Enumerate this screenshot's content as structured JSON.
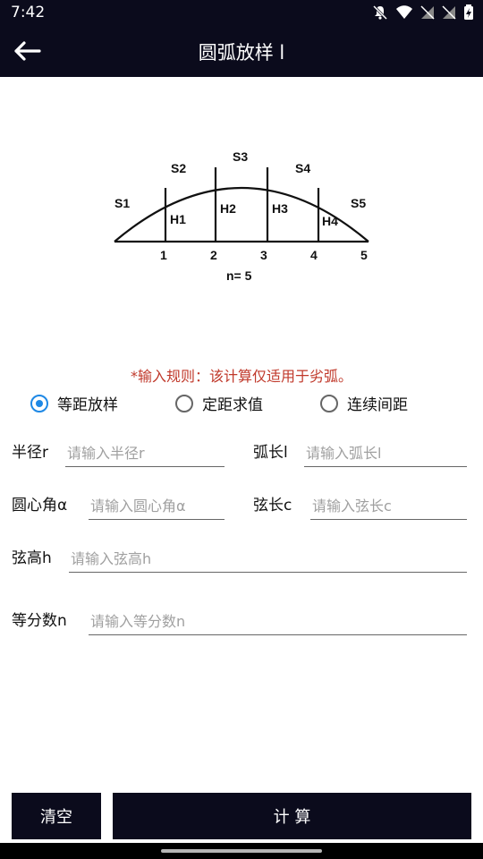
{
  "status": {
    "time": "7:42"
  },
  "header": {
    "title": "圆弧放样 l"
  },
  "diagram": {
    "arc_labels": [
      "S1",
      "S2",
      "S3",
      "S4",
      "S5"
    ],
    "height_labels": [
      "H1",
      "H2",
      "H3",
      "H4"
    ],
    "point_labels": [
      "1",
      "2",
      "3",
      "4",
      "5"
    ],
    "n_label": "n= 5"
  },
  "rule_text": "*输入规则：该计算仅适用于劣弧。",
  "modes": [
    {
      "label": "等距放样",
      "selected": true
    },
    {
      "label": "定距求值",
      "selected": false
    },
    {
      "label": "连续间距",
      "selected": false
    }
  ],
  "fields": {
    "radius": {
      "label": "半径r",
      "placeholder": "请输入半径r"
    },
    "arc_length": {
      "label": "弧长l",
      "placeholder": "请输入弧长l"
    },
    "central_angle": {
      "label": "圆心角α",
      "placeholder": "请输入圆心角α"
    },
    "chord_length": {
      "label": "弦长c",
      "placeholder": "请输入弦长c"
    },
    "chord_height": {
      "label": "弦高h",
      "placeholder": "请输入弦高h"
    },
    "divisions": {
      "label": "等分数n",
      "placeholder": "请输入等分数n"
    }
  },
  "buttons": {
    "clear": "清空",
    "calculate": "计 算"
  }
}
